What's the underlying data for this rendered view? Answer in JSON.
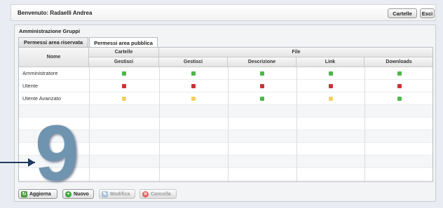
{
  "header": {
    "welcome": "Benvenuto: Radaelli Andrea",
    "cartelle_button": "Cartelle",
    "esci_button": "Esci"
  },
  "panel": {
    "title": "Amministrazione Gruppi",
    "tabs": [
      {
        "label": "Permessi area riservata",
        "active": false
      },
      {
        "label": "Permessi area pubblica",
        "active": true
      }
    ]
  },
  "grid": {
    "groups": {
      "cartelle": "Cartelle",
      "file": "File"
    },
    "columns": [
      "Nome",
      "Gestisci",
      "Gestisci",
      "Descrizione",
      "Link",
      "Downloads"
    ],
    "rows": [
      {
        "name": "Amministratore",
        "perms": [
          "green",
          "green",
          "green",
          "green",
          "green"
        ]
      },
      {
        "name": "Utente",
        "perms": [
          "red",
          "red",
          "red",
          "red",
          "red"
        ]
      },
      {
        "name": "Utente Avanzato",
        "perms": [
          "yellow",
          "yellow",
          "green",
          "yellow",
          "green"
        ]
      }
    ]
  },
  "toolbar": {
    "aggiorna": "Aggiorna",
    "nuovo": "Nuovo",
    "modifica": "Modifica",
    "cancella": "Cancella"
  },
  "annotation": {
    "number": "9"
  },
  "colors": {
    "green": "#4cb848",
    "red": "#cf3035",
    "yellow": "#f3d060"
  }
}
